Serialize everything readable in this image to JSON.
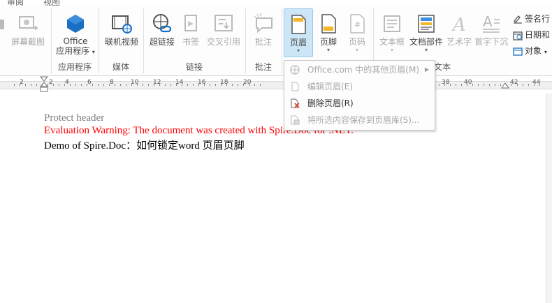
{
  "tabs": {
    "review": "审阅",
    "view": "视图"
  },
  "ribbon": {
    "screenshot_label": "屏幕截图",
    "office_apps": {
      "line1": "Office",
      "line2": "应用程序"
    },
    "online_video": "联机视频",
    "hyperlink": "超链接",
    "bookmark": "书签",
    "cross_ref": "交叉引用",
    "comment": "批注",
    "header": "页眉",
    "footer": "页脚",
    "page_number": "页码",
    "textbox": "文本框",
    "doc_parts": "文档部件",
    "wordart": "艺术字",
    "dropcap": "首字下沉",
    "signature_line": "签名行",
    "date_time": "日期和",
    "object": "对象",
    "groups": {
      "apps": "应用程序",
      "media": "媒体",
      "links": "链接",
      "comments": "批注",
      "text": "文本"
    }
  },
  "ruler": {
    "left_numbers": [
      "2",
      "2",
      "4",
      "6",
      "8",
      "10",
      "12",
      "14",
      "16",
      "18",
      "20"
    ],
    "right_numbers": [
      "38",
      "40",
      "42",
      "44"
    ]
  },
  "menu": {
    "items": [
      {
        "label": "Office.com 中的其他页眉(M)",
        "enabled": false
      },
      {
        "label": "编辑页眉(E)",
        "enabled": false
      },
      {
        "label": "删除页眉(R)",
        "enabled": true
      },
      {
        "label": "将所选内容保存到页眉库(S)...",
        "enabled": false
      }
    ]
  },
  "document": {
    "line1": "Protect header",
    "line2": "Evaluation Warning: The document was created with Spire.Doc for .NET.",
    "line3": "Demo of Spire.Doc：如何锁定word 页眉页脚"
  },
  "colors": {
    "warning": "#ff0000",
    "header_text": "#7f7f7f",
    "accent_blue": "#1a6fc4"
  }
}
